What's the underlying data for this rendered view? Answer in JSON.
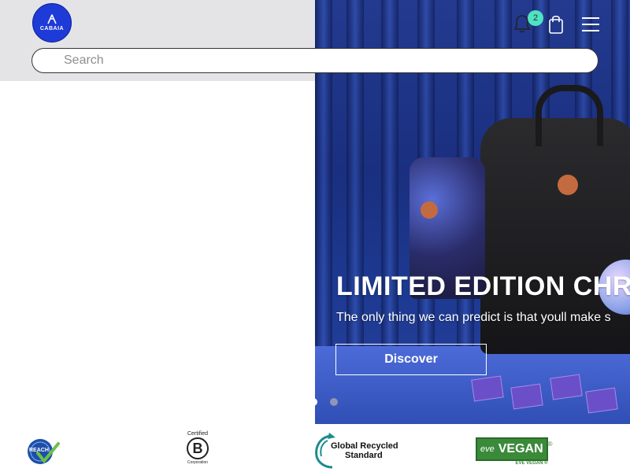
{
  "header": {
    "logo_text": "CABAIA",
    "notification_count": "2",
    "search_placeholder": "Search"
  },
  "hero": {
    "title": "LIMITED EDITION CHRI",
    "subtitle": "The only thing we can predict is that youll make s",
    "button_label": "Discover",
    "slides": 2,
    "active_slide": 1
  },
  "certifications": {
    "reach": {
      "label": "REACH"
    },
    "bcorp": {
      "top": "Certified",
      "letter": "B",
      "bottom": "Corporation"
    },
    "grs": {
      "line1": "Global Recycled",
      "line2": "Standard"
    },
    "vegan": {
      "brand": "eve",
      "label": "VEGAN",
      "registered": "®",
      "caption": "EVE VEGAN ®"
    }
  },
  "icons": {
    "logo": "cabaia-logo",
    "notification": "bell-icon",
    "cart": "shopping-bag-icon",
    "menu": "hamburger-menu-icon"
  },
  "colors": {
    "header_bg": "#e4e4e6",
    "logo_blue": "#1e3bd8",
    "badge": "#4fe3c1",
    "vegan_green": "#3a8a3a"
  }
}
